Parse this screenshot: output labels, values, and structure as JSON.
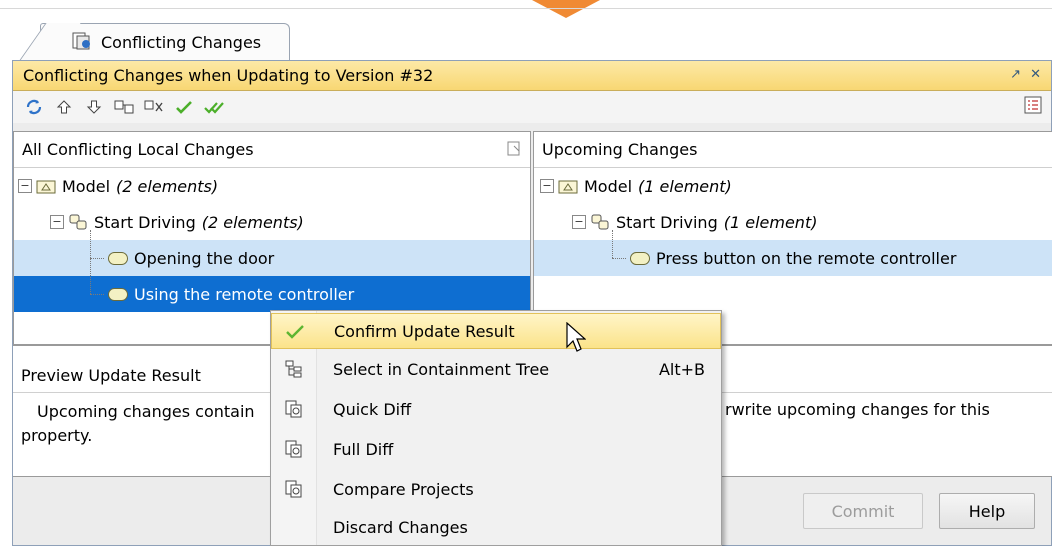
{
  "tab": {
    "label": "Conflicting Changes"
  },
  "window": {
    "title": "Conflicting Changes when Updating to Version #32",
    "pin_label": "↗",
    "close_label": "✕"
  },
  "toolbar": {
    "icons": [
      "refresh-icon",
      "up-arrow-icon",
      "down-arrow-icon",
      "accept-diagram-icon",
      "reject-diagram-icon",
      "check-icon",
      "double-check-icon"
    ],
    "settings_icon": "list-settings-icon"
  },
  "left_pane": {
    "header": "All Conflicting Local Changes",
    "rows": [
      {
        "label": "Model",
        "count": "(2 elements)"
      },
      {
        "label": "Start Driving",
        "count": "(2 elements)"
      },
      {
        "label": "Opening the door"
      },
      {
        "label": "Using the remote controller"
      }
    ]
  },
  "right_pane": {
    "header": "Upcoming Changes",
    "rows": [
      {
        "label": "Model",
        "count": "(1 element)"
      },
      {
        "label": "Start Driving",
        "count": "(1 element)"
      },
      {
        "label": "Press button on the remote controller"
      }
    ]
  },
  "preview": {
    "header": "Preview Update Result",
    "body_left": "Upcoming changes contain",
    "body_left_2": "property.",
    "body_right": "rwrite upcoming changes for this"
  },
  "buttons": {
    "commit": "Commit",
    "help": "Help"
  },
  "context_menu": {
    "items": [
      {
        "label": "Confirm Update Result",
        "icon": "check-icon",
        "shortcut": ""
      },
      {
        "label": "Select in Containment Tree",
        "icon": "containment-tree-icon",
        "shortcut": "Alt+B"
      },
      {
        "label": "Quick Diff",
        "icon": "diff-icon",
        "shortcut": ""
      },
      {
        "label": "Full Diff",
        "icon": "diff-icon",
        "shortcut": ""
      },
      {
        "label": "Compare Projects",
        "icon": "diff-icon",
        "shortcut": ""
      },
      {
        "label": "Discard Changes",
        "icon": "",
        "shortcut": ""
      }
    ]
  },
  "colors": {
    "selection_light": "#cde3f7",
    "selection_dark": "#0e6ed1",
    "title_bar": "#f8d773",
    "accent_orange": "#f08a34"
  }
}
